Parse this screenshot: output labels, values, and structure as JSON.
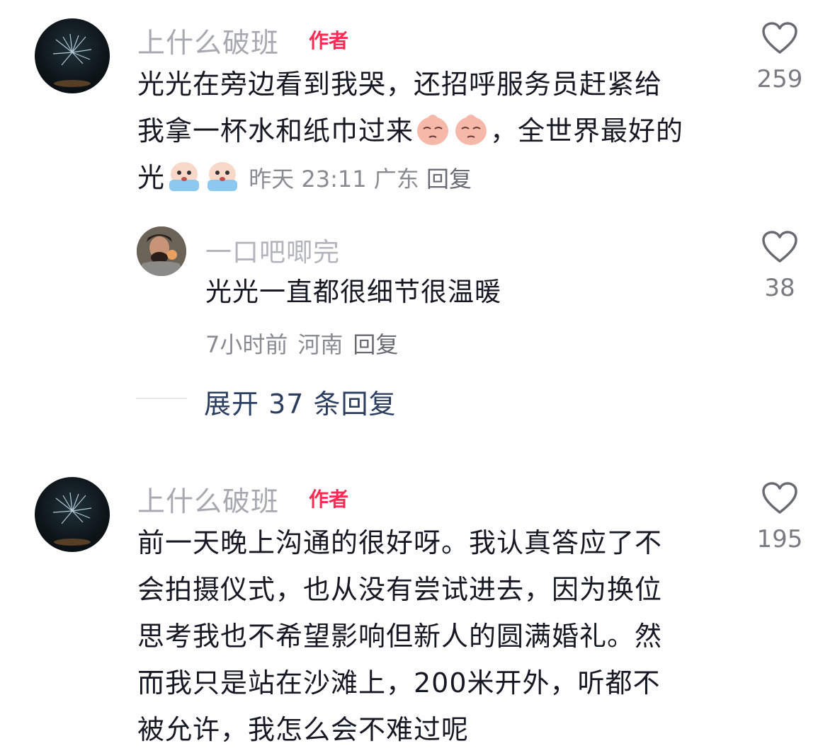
{
  "comments": [
    {
      "author": "上什么破班",
      "badge": "作者",
      "text_line1": "光光在旁边看到我哭，还招呼服务员赶紧给",
      "text_line2a": "我拿一杯水和纸巾过来",
      "text_line2b": "，全世界最好的",
      "text_line3a": "光",
      "time": "昨天 23:11",
      "location": "广东",
      "reply_label": "回复",
      "likes": "259"
    },
    {
      "author": "一口吧唧完",
      "text": "光光一直都很细节很温暖",
      "time": "7小时前",
      "location": "河南",
      "reply_label": "回复",
      "likes": "38"
    },
    {
      "author": "上什么破班",
      "badge": "作者",
      "lines": [
        "前一天晚上沟通的很好呀。我认真答应了不",
        "会拍摄仪式，也从没有尝试进去，因为换位",
        "思考我也不希望影响但新人的圆满婚礼。然",
        "而我只是站在沙滩上，200米开外，听都不",
        "被允许，我怎么会不难过呢"
      ],
      "likes": "195"
    }
  ],
  "expand_label": "展开 37 条回复",
  "colors": {
    "badge": "#fe2c55",
    "expand": "#2c3e60",
    "meta": "#8a8b91"
  }
}
